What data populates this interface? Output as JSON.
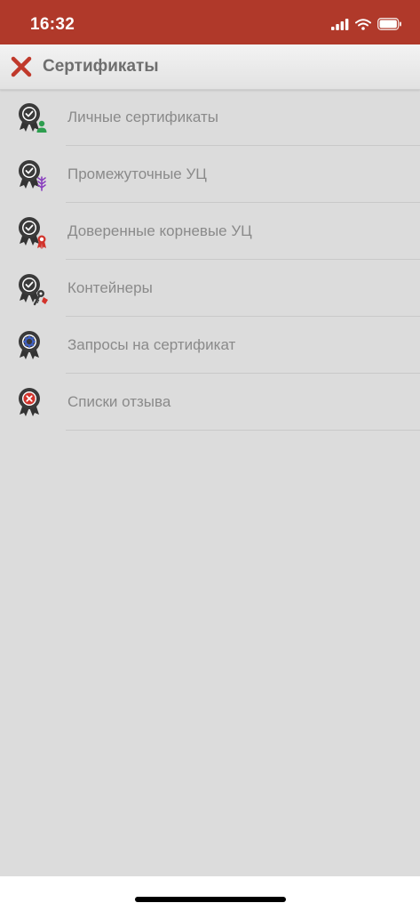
{
  "status_bar": {
    "time": "16:32",
    "icons": [
      "signal-icon",
      "wifi-icon",
      "battery-icon"
    ]
  },
  "header": {
    "title": "Сертификаты",
    "close_icon": "close-icon"
  },
  "colors": {
    "status_bar": "#b0392a",
    "close_icon": "#c0392b",
    "background": "#dcdcdc",
    "label_text": "#8a8a8a"
  },
  "menu": {
    "items": [
      {
        "label": "Личные сертификаты",
        "icon": "personal-certificate-icon"
      },
      {
        "label": "Промежуточные УЦ",
        "icon": "intermediate-ca-icon"
      },
      {
        "label": "Доверенные корневые УЦ",
        "icon": "trusted-root-ca-icon"
      },
      {
        "label": "Контейнеры",
        "icon": "container-key-icon"
      },
      {
        "label": "Запросы на сертификат",
        "icon": "certificate-request-icon"
      },
      {
        "label": "Списки отзыва",
        "icon": "revocation-list-icon"
      }
    ]
  }
}
